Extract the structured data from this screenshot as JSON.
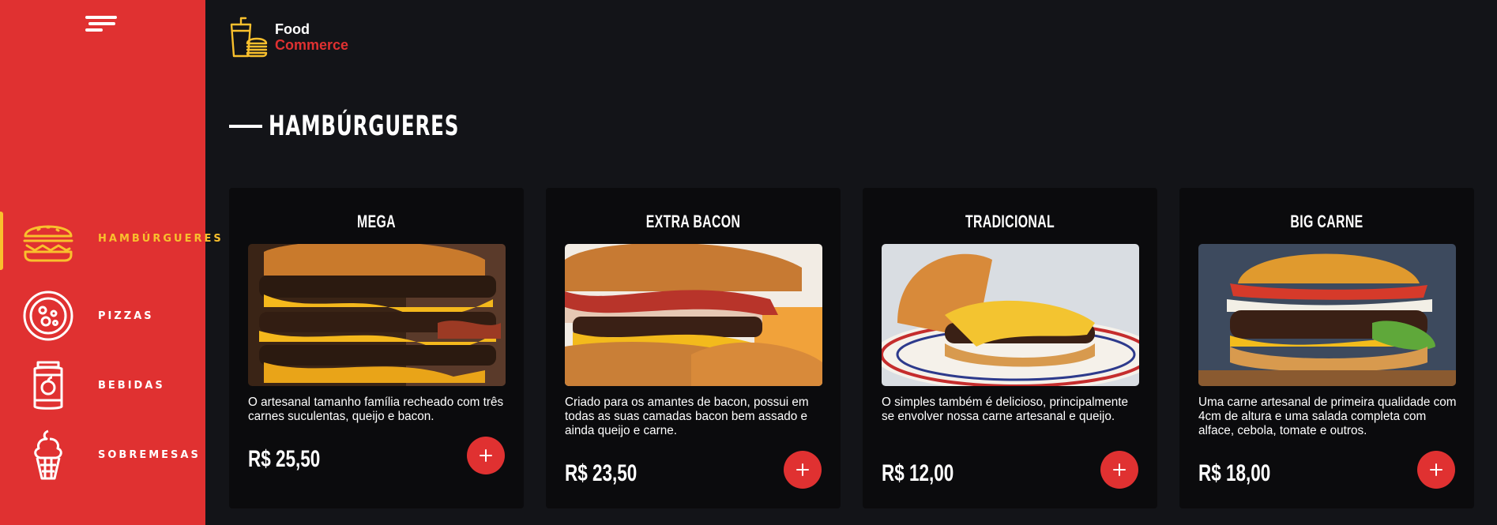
{
  "colors": {
    "accent": "#e03131",
    "highlight": "#f9c02d",
    "background": "#131418",
    "card": "#0b0b0d"
  },
  "logo": {
    "line1": "Food",
    "line2": "Commerce",
    "icon": "fast-food-icon"
  },
  "sidebar": {
    "toggle_icon": "menu-icon",
    "items": [
      {
        "label": "HAMBÚRGUERES",
        "icon": "burger-icon",
        "active": true
      },
      {
        "label": "PIZZAS",
        "icon": "pizza-icon",
        "active": false
      },
      {
        "label": "BEBIDAS",
        "icon": "drink-can-icon",
        "active": false
      },
      {
        "label": "SOBREMESAS",
        "icon": "ice-cream-icon",
        "active": false
      }
    ]
  },
  "main": {
    "section_title": "HAMBÚRGUERES",
    "products": [
      {
        "name": "MEGA",
        "description": "O artesanal tamanho família recheado com três carnes suculentas, queijo e bacon.",
        "price": "R$ 25,50"
      },
      {
        "name": "EXTRA BACON",
        "description": "Criado para os amantes de bacon, possui em todas as suas camadas bacon bem assado e ainda queijo e carne.",
        "price": "R$ 23,50"
      },
      {
        "name": "TRADICIONAL",
        "description": "O simples também é delicioso, principalmente se envolver nossa carne artesanal e queijo.",
        "price": "R$ 12,00"
      },
      {
        "name": "BIG CARNE",
        "description": "Uma carne artesanal de primeira qualidade com 4cm de altura e uma salada completa com alface, cebola, tomate e outros.",
        "price": "R$ 18,00"
      }
    ]
  }
}
